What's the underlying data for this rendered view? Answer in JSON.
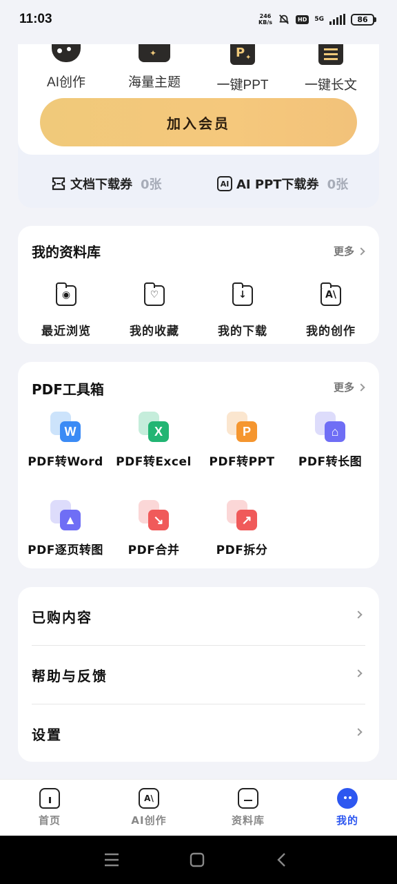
{
  "status_bar": {
    "time": "11:03",
    "speed_value": "246",
    "speed_unit": "KB/s",
    "hd": "HD",
    "network": "5G",
    "battery": "86"
  },
  "benefits": [
    {
      "label": "AI创作",
      "icon": "palette-icon"
    },
    {
      "label": "海量主题",
      "icon": "tshirt-icon"
    },
    {
      "label": "一键PPT",
      "icon": "ppt-spark-icon"
    },
    {
      "label": "一键长文",
      "icon": "document-lines-icon"
    }
  ],
  "membership": {
    "join_label": "加入会员",
    "colors": {
      "button_start": "#f0c97a",
      "button_end": "#f2c27a"
    }
  },
  "coupons": [
    {
      "label": "文档下载券",
      "count": "0张",
      "icon": "ticket-icon"
    },
    {
      "label": "AI PPT下载券",
      "count": "0张",
      "icon": "ai-icon"
    }
  ],
  "library": {
    "title": "我的资料库",
    "more": "更多",
    "items": [
      {
        "label": "最近浏览",
        "icon": "eye-folder-icon"
      },
      {
        "label": "我的收藏",
        "icon": "heart-folder-icon"
      },
      {
        "label": "我的下载",
        "icon": "download-folder-icon"
      },
      {
        "label": "我的创作",
        "icon": "ai-folder-icon"
      }
    ]
  },
  "toolbox": {
    "title": "PDF工具箱",
    "more": "更多",
    "tools": [
      {
        "label": "PDF转Word",
        "icon": "pdf-to-word-icon",
        "glyph": "W",
        "color": "#3b8bf5",
        "back": "#8ec0f7"
      },
      {
        "label": "PDF转Excel",
        "icon": "pdf-to-excel-icon",
        "glyph": "X",
        "color": "#22b573",
        "back": "#7fd8b0"
      },
      {
        "label": "PDF转PPT",
        "icon": "pdf-to-ppt-icon",
        "glyph": "P",
        "color": "#f5962f",
        "back": "#f7c894"
      },
      {
        "label": "PDF转长图",
        "icon": "pdf-to-long-image-icon",
        "glyph": "⌂",
        "color": "#6f6ef5",
        "back": "#b3b2f7"
      },
      {
        "label": "PDF逐页转图",
        "icon": "pdf-page-to-image-icon",
        "glyph": "▲",
        "color": "#6f6ef5",
        "back": "#b3b2f7"
      },
      {
        "label": "PDF合并",
        "icon": "pdf-merge-icon",
        "glyph": "↘",
        "color": "#f05a5a",
        "back": "#f7a7a7"
      },
      {
        "label": "PDF拆分",
        "icon": "pdf-split-icon",
        "glyph": "↗",
        "color": "#f05a5a",
        "back": "#f7a7a7"
      }
    ]
  },
  "menu": [
    {
      "label": "已购内容"
    },
    {
      "label": "帮助与反馈"
    },
    {
      "label": "设置"
    }
  ],
  "bottom_nav": [
    {
      "label": "首页",
      "icon": "home-icon"
    },
    {
      "label": "AI创作",
      "icon": "ai-create-icon"
    },
    {
      "label": "资料库",
      "icon": "library-icon"
    },
    {
      "label": "我的",
      "icon": "profile-face-icon",
      "active": true
    }
  ],
  "accent_color": "#2d57f0"
}
